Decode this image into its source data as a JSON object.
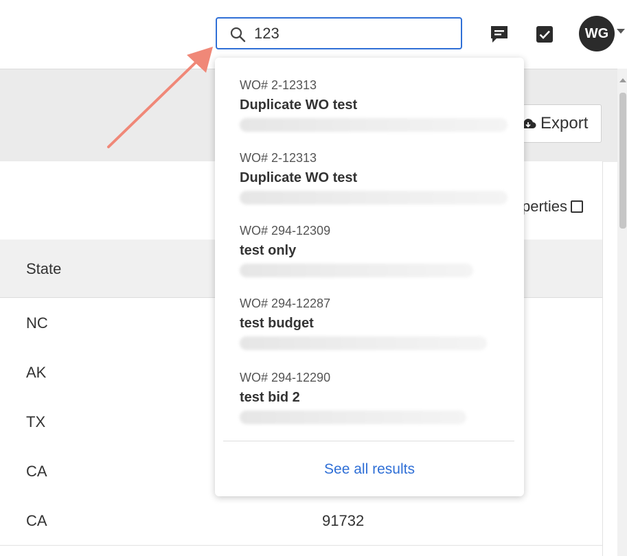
{
  "search": {
    "value": "123"
  },
  "user": {
    "initials": "WG"
  },
  "toolbar": {
    "export_label": "Export"
  },
  "filters": {
    "properties_label": "perties"
  },
  "table": {
    "header_state": "State",
    "rows": [
      {
        "state": "NC",
        "zip": ""
      },
      {
        "state": "AK",
        "zip": ""
      },
      {
        "state": "TX",
        "zip": ""
      },
      {
        "state": "CA",
        "zip": ""
      },
      {
        "state": "CA",
        "zip": "91732"
      }
    ]
  },
  "dropdown": {
    "results": [
      {
        "wo": "WO# 2-12313",
        "title": "Duplicate WO test"
      },
      {
        "wo": "WO# 2-12313",
        "title": "Duplicate WO test"
      },
      {
        "wo": "WO# 294-12309",
        "title": "test only"
      },
      {
        "wo": "WO# 294-12287",
        "title": "test budget"
      },
      {
        "wo": "WO# 294-12290",
        "title": "test bid 2"
      }
    ],
    "see_all_label": "See all results"
  },
  "colors": {
    "accent": "#2f6fd6",
    "annotation_arrow": "#f08878"
  }
}
